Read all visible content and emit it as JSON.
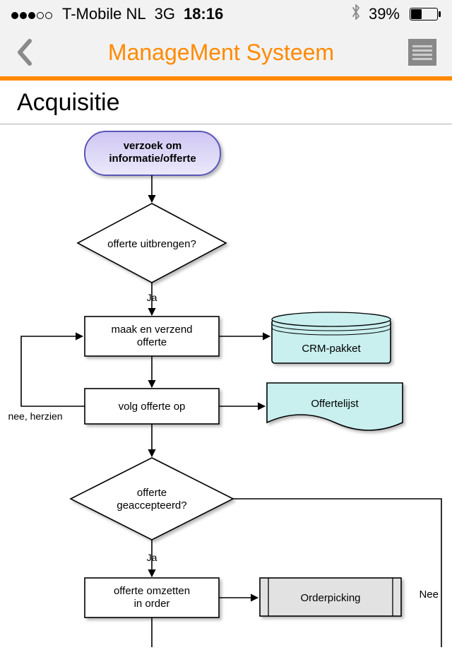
{
  "statusbar": {
    "carrier": "T-Mobile NL",
    "network": "3G",
    "time": "18:16",
    "battery_pct": "39%",
    "bluetooth_icon": "bluetooth-icon",
    "signal_dots_filled": 3,
    "signal_dots_total": 5
  },
  "header": {
    "title": "ManageMent Systeem"
  },
  "section": {
    "title": "Acquisitie"
  },
  "flow": {
    "start": "verzoek om informatie/offerte",
    "decision1": "offerte uitbrengen?",
    "decision1_yes": "Ja",
    "step_make": "maak en verzend offerte",
    "data_crm": "CRM-pakket",
    "step_follow": "volg offerte op",
    "doc_list": "Offertelijst",
    "loop_label": "nee, herzien",
    "decision2": "offerte geaccepteerd?",
    "decision2_yes": "Ja",
    "decision2_no": "Nee",
    "step_convert": "offerte omzetten in order",
    "ref_orderpick": "Orderpicking"
  }
}
